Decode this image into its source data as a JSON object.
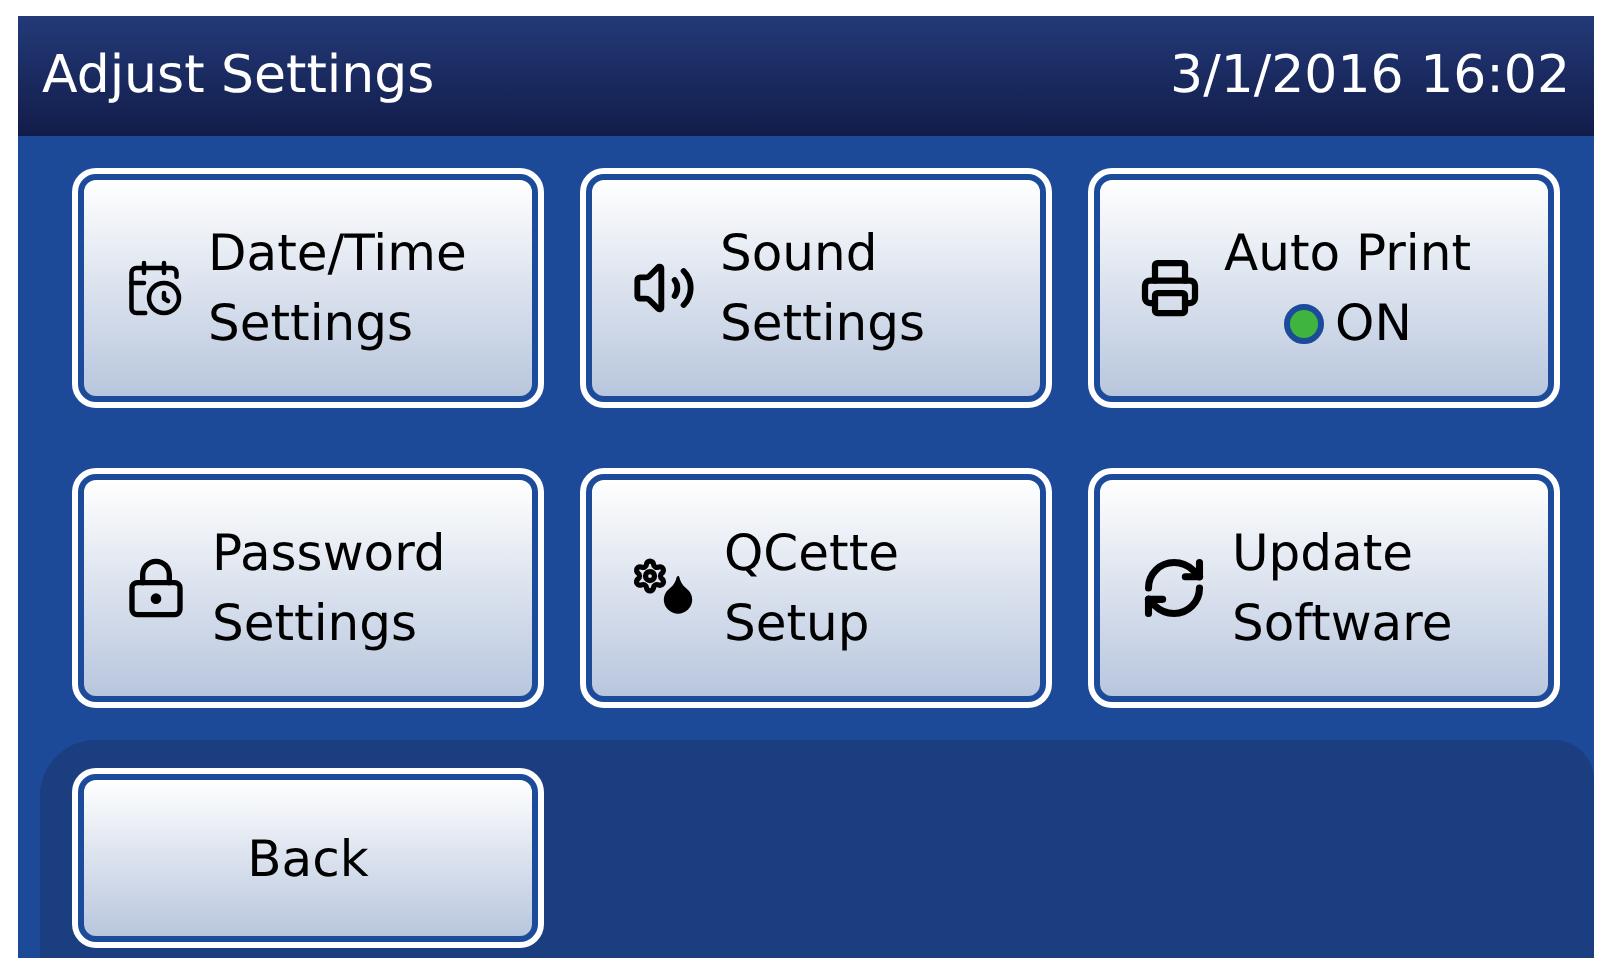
{
  "header": {
    "title": "Adjust Settings",
    "datetime": "3/1/2016 16:02"
  },
  "buttons": [
    {
      "lines": [
        "Date/Time",
        "Settings"
      ]
    },
    {
      "lines": [
        "Sound",
        "Settings"
      ]
    },
    {
      "lines": [
        "Auto Print"
      ],
      "status": {
        "label": "ON",
        "on": true
      }
    },
    {
      "lines": [
        "Password",
        "Settings"
      ]
    },
    {
      "lines": [
        "QCette",
        "Setup"
      ]
    },
    {
      "lines": [
        "Update",
        "Software"
      ]
    }
  ],
  "back_button": {
    "label": "Back"
  }
}
